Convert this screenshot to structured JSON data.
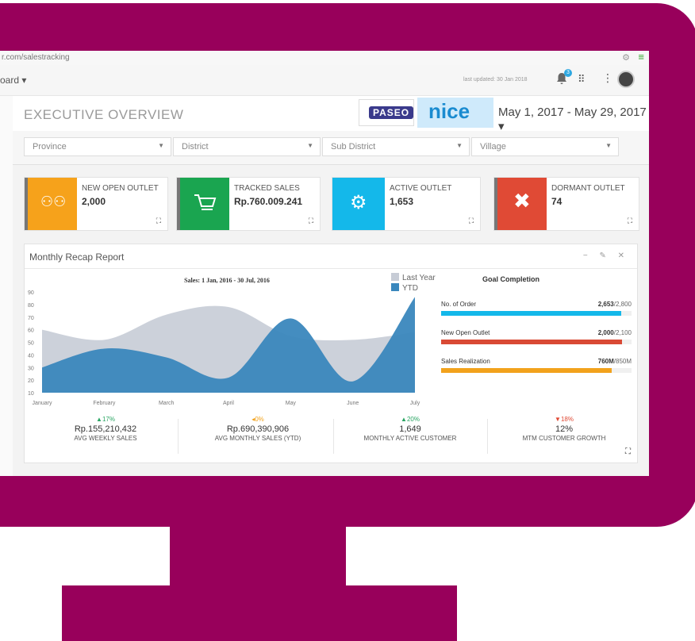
{
  "browser": {
    "url": "r.com/salestracking"
  },
  "appbar": {
    "breadcrumb": "oard ▾",
    "last_updated": "last updated: 30 Jan 2018",
    "notification_count": "3"
  },
  "header": {
    "title": "EXECUTIVE OVERVIEW",
    "brand1": "PASEO",
    "brand2": "nice",
    "date_range": "May 1, 2017 - May 29, 2017 ▾"
  },
  "filters": [
    {
      "label": "Province"
    },
    {
      "label": "District"
    },
    {
      "label": "Sub District"
    },
    {
      "label": "Village"
    }
  ],
  "cards": [
    {
      "label": "NEW OPEN OUTLET",
      "value": "2,000",
      "color": "#f6a21b",
      "icon": "people-icon"
    },
    {
      "label": "TRACKED SALES",
      "value": "Rp.760.009.241",
      "color": "#1aa550",
      "icon": "cart-icon"
    },
    {
      "label": "ACTIVE OUTLET",
      "value": "1,653",
      "color": "#14b8ea",
      "icon": "gear-icon"
    },
    {
      "label": "DORMANT OUTLET",
      "value": "74",
      "color": "#e04a35",
      "icon": "cross-icon"
    }
  ],
  "panel": {
    "title": "Monthly Recap Report"
  },
  "chart_data": {
    "type": "area",
    "title": "Sales: 1 Jan, 2016 - 30 Jul, 2016",
    "categories": [
      "January",
      "February",
      "March",
      "April",
      "May",
      "June",
      "July"
    ],
    "y_ticks": [
      10,
      20,
      30,
      40,
      50,
      60,
      70,
      80,
      90
    ],
    "ylim": [
      10,
      90
    ],
    "series": [
      {
        "name": "Last Year",
        "color": "#c7ccd6",
        "values": [
          60,
          52,
          72,
          78,
          55,
          52,
          58
        ]
      },
      {
        "name": "YTD",
        "color": "#3a87bd",
        "values": [
          30,
          45,
          38,
          22,
          69,
          19,
          86
        ]
      }
    ],
    "legend": "top-right"
  },
  "goals": {
    "title": "Goal Completion",
    "items": [
      {
        "label": "No. of Order",
        "value": "2,653",
        "target": "/2,800",
        "color": "#14b8ea",
        "progress": 0.947
      },
      {
        "label": "New Open Outlet",
        "value": "2,000",
        "target": "/2,100",
        "color": "#d94a35",
        "progress": 0.952
      },
      {
        "label": "Sales Realization",
        "value": "760M",
        "target": "/850M",
        "color": "#f2a21c",
        "progress": 0.894
      }
    ]
  },
  "kpis": [
    {
      "delta": "▲17%",
      "delta_color": "#2aa563",
      "value": "Rp.155,210,432",
      "label": "AVG WEEKLY SALES"
    },
    {
      "delta": "◂0%",
      "delta_color": "#f2a21c",
      "value": "Rp.690,390,906",
      "label": "AVG MONTHLY SALES (YTD)"
    },
    {
      "delta": "▲20%",
      "delta_color": "#2aa563",
      "value": "1,649",
      "label": "MONTHLY ACTIVE CUSTOMER"
    },
    {
      "delta": "▼18%",
      "delta_color": "#e04a35",
      "value": "12%",
      "label": "MTM CUSTOMER GROWTH"
    }
  ]
}
